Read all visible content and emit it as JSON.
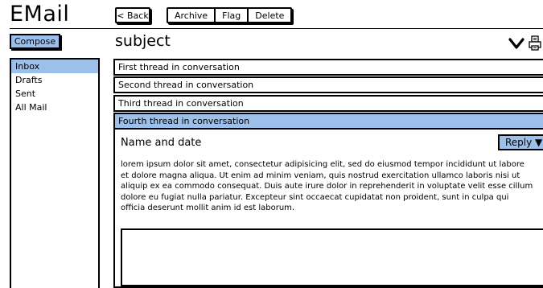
{
  "app": {
    "title": "EMail"
  },
  "toolbar": {
    "back_label": "< Back",
    "archive_label": "Archive",
    "flag_label": "Flag",
    "delete_label": "Delete"
  },
  "sidebar": {
    "compose_label": "Compose",
    "items": [
      {
        "label": "Inbox",
        "active": true
      },
      {
        "label": "Drafts"
      },
      {
        "label": "Sent"
      },
      {
        "label": "All Mail"
      }
    ]
  },
  "message": {
    "subject": "subject",
    "expand_icon": "chevron-down-icon",
    "print_icon": "printer-icon",
    "threads": [
      {
        "label": "First thread in conversation"
      },
      {
        "label": "Second thread in conversation"
      },
      {
        "label": "Third thread in conversation"
      },
      {
        "label": "Fourth thread in conversation",
        "selected": true
      }
    ],
    "sender_line": "Name and date",
    "reply_label": "Reply ▼",
    "body": "lorem ipsum dolor sit amet, consectetur adipisicing elit, sed do eiusmod tempor incididunt ut labore et dolore magna aliqua. Ut enim ad minim veniam, quis nostrud exercitation ullamco laboris nisi ut aliquip ex ea commodo consequat. Duis aute irure dolor in reprehenderit in voluptate velit esse cillum dolore eu fugiat nulla pariatur. Excepteur sint occaecat cupidatat non proident, sunt in culpa qui officia deserunt mollit anim id est laborum.",
    "reply_box_value": ""
  },
  "colors": {
    "accent": "#9dc0ea"
  }
}
